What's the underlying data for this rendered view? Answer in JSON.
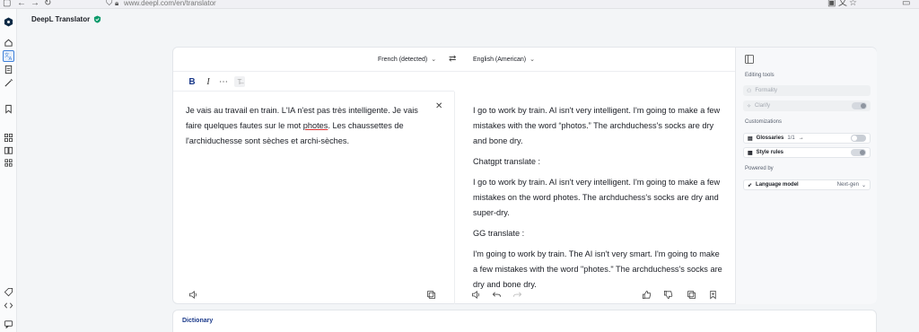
{
  "browser": {
    "url": "www.deepl.com/en/translator"
  },
  "app": {
    "title": "DeepL Translator"
  },
  "langbar": {
    "source_lang": "French (detected)",
    "target_lang": "English (American)"
  },
  "source": {
    "text_before": "Je vais au travail en train. L'IA n'est pas très intelligente. Je vais faire quelques fautes sur le mot ",
    "underlined": "photes",
    "text_after": ". Les chaussettes de l'archiduchesse sont sèches et archi-sèches."
  },
  "target": {
    "paragraphs": [
      "I go to work by train. AI isn't very intelligent. I'm going to make a few mistakes with the word “photos.” The archduchess's socks are dry and bone dry.",
      "Chatgpt translate :",
      "I go to work by train. AI isn't very intelligent. I'm going to make a few mistakes on the word photes. The archduchess's socks are dry and super-dry.",
      "GG translate :",
      "I'm going to work by train. The AI isn't very smart. I'm going to make a few mistakes with the word \"photes.\" The archduchess's socks are dry and bone dry."
    ]
  },
  "panel": {
    "editing_tools": "Editing tools",
    "formality": "Formality",
    "clarify": "Clarify",
    "customizations": "Customizations",
    "glossaries": "Glossaries",
    "glossaries_count": "1/1",
    "style_rules": "Style rules",
    "powered_by": "Powered by",
    "language_model": "Language model",
    "model_value": "Next-gen"
  },
  "dictionary": {
    "label": "Dictionary"
  },
  "colors": {
    "accent": "#1b3a8a",
    "brand": "#0f2b46"
  }
}
